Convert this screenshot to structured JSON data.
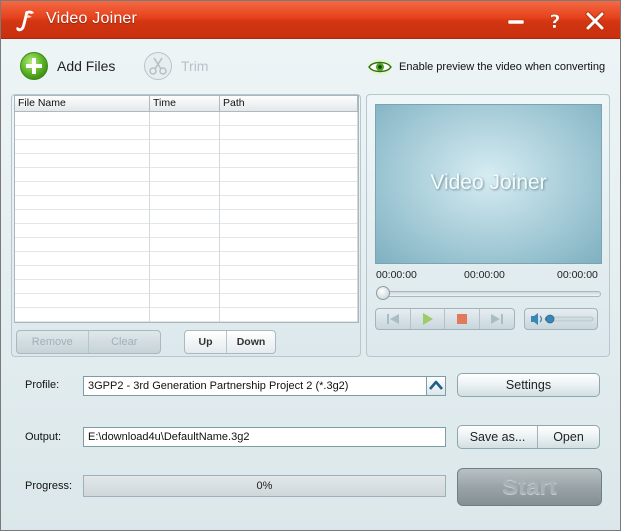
{
  "window": {
    "title": "Video Joiner"
  },
  "toolbar": {
    "add_files_label": "Add Files",
    "trim_label": "Trim",
    "preview_option_label": "Enable preview the video when converting"
  },
  "file_list": {
    "columns": [
      "File Name",
      "Time",
      "Path"
    ],
    "rows": [],
    "remove_label": "Remove",
    "clear_label": "Clear",
    "up_label": "Up",
    "down_label": "Down"
  },
  "preview": {
    "screen_text": "Video Joiner",
    "time_start": "00:00:00",
    "time_current": "00:00:00",
    "time_end": "00:00:00"
  },
  "profile": {
    "label": "Profile:",
    "value": "3GPP2 - 3rd Generation Partnership Project 2 (*.3g2)",
    "settings_label": "Settings"
  },
  "output": {
    "label": "Output:",
    "value": "E:\\download4u\\DefaultName.3g2",
    "save_as_label": "Save as...",
    "open_label": "Open"
  },
  "progress": {
    "label": "Progress:",
    "value_text": "0%",
    "fraction": 0
  },
  "start_label": "Start",
  "colors": {
    "title_bar": "#e5421c",
    "accent_green": "#5fb82a"
  },
  "icons": {
    "app": "video-joiner-logo-icon",
    "minimize": "minimize-icon",
    "help": "help-icon",
    "close": "close-icon",
    "add": "plus-circle-icon",
    "trim": "scissors-icon",
    "preview": "eye-icon",
    "prev": "skip-back-icon",
    "play": "play-icon",
    "stop": "stop-icon",
    "next": "skip-forward-icon",
    "volume": "speaker-icon",
    "dropdown": "chevron-up-icon"
  }
}
